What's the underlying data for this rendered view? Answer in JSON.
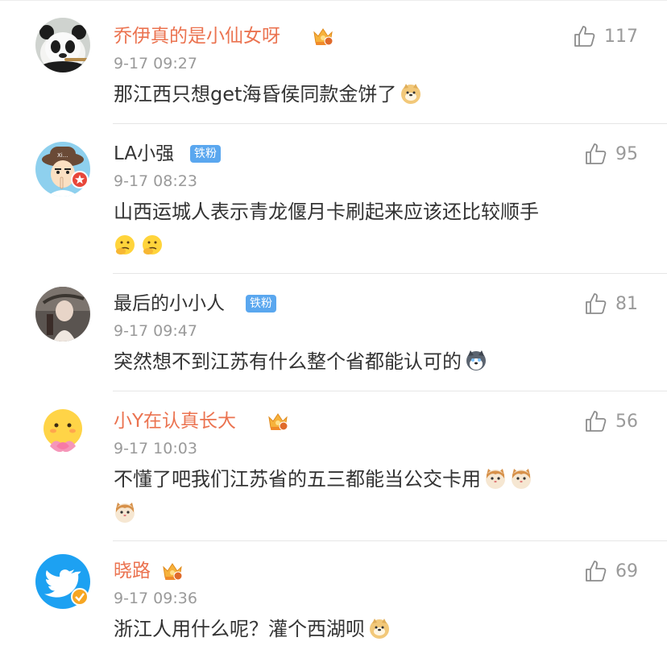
{
  "comments": [
    {
      "username": "乔伊真的是小仙女呀",
      "name_style": "vip",
      "badge": "crown",
      "time": "9-17 09:27",
      "text": "那江西只想get海昏侯同款金饼了",
      "emojis": [
        "doge-emoji"
      ],
      "likes": "117",
      "avatar": "panda-avatar"
    },
    {
      "username": "LA小强",
      "name_style": "normal",
      "badge": "铁粉",
      "time": "9-17 08:23",
      "text": "山西运城人表示青龙偃月卡刷起来应该还比较顺手",
      "emojis_next_line": [
        "thinking-emoji",
        "thinking-emoji"
      ],
      "likes": "95",
      "avatar": "cartoon-boy-avatar"
    },
    {
      "username": "最后的小小人",
      "name_style": "normal",
      "badge": "铁粉",
      "time": "9-17 09:47",
      "text": "突然想不到江苏有什么整个省都能认可的",
      "emojis": [
        "husky-emoji"
      ],
      "likes": "81",
      "avatar": "photo-avatar"
    },
    {
      "username": "小Y在认真长大",
      "name_style": "vip",
      "badge": "crown",
      "time": "9-17 10:03",
      "text": "不懂了吧我们江苏省的五三都能当公交卡用",
      "emojis": [
        "cat-emoji",
        "cat-emoji"
      ],
      "emojis_next_line": [
        "cat-emoji"
      ],
      "likes": "56",
      "avatar": "lotus-face-avatar"
    },
    {
      "username": "晓路",
      "name_style": "vip",
      "badge": "crown",
      "time": "9-17 09:36",
      "text": "浙江人用什么呢？灌个西湖呗",
      "emojis": [
        "doge-emoji"
      ],
      "likes": "69",
      "avatar": "twitter-bird-avatar"
    }
  ],
  "colors": {
    "vip_name": "#eb7350",
    "normal_text": "#333333",
    "meta": "#9a9a9a",
    "fan_badge": "#5aa7ef",
    "divider": "#e6e6e6"
  }
}
